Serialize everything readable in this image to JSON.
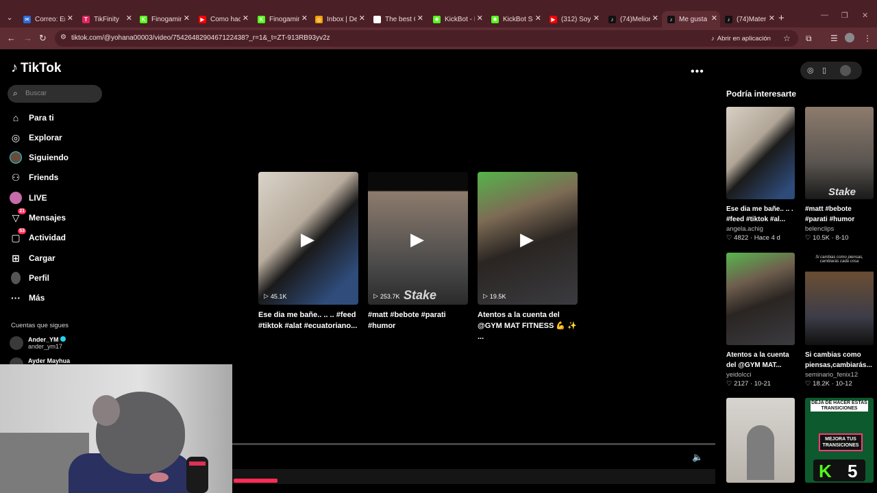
{
  "browser": {
    "tabs": [
      {
        "title": "Correo: En",
        "color": "#2b6cd8",
        "glyph": "✉"
      },
      {
        "title": "TikFinity",
        "color": "#e0245e",
        "glyph": "T"
      },
      {
        "title": "Finogamin",
        "color": "#53fc18",
        "glyph": "K"
      },
      {
        "title": "Como hac",
        "color": "#ff0000",
        "glyph": "▶"
      },
      {
        "title": "Finogamin",
        "color": "#53fc18",
        "glyph": "K"
      },
      {
        "title": "Inbox | De",
        "color": "#f0a000",
        "glyph": "◎"
      },
      {
        "title": "The best C",
        "color": "#ffffff",
        "glyph": "●"
      },
      {
        "title": "KickBot - I",
        "color": "#53fc18",
        "glyph": "✱"
      },
      {
        "title": "KickBot Se",
        "color": "#53fc18",
        "glyph": "✱"
      },
      {
        "title": "(312) Soy",
        "color": "#ff0000",
        "glyph": "▶"
      },
      {
        "title": "(74)Melior",
        "color": "#111111",
        "glyph": "♪"
      },
      {
        "title": "Me gusta",
        "color": "#111111",
        "glyph": "♪",
        "active": true
      },
      {
        "title": "(74)Mater",
        "color": "#111111",
        "glyph": "♪"
      }
    ],
    "url": "tiktok.com/@yohana00003/video/7542648290467122438?_r=1&_t=ZT-913RB93yv2z",
    "open_app": "Abrir en aplicación"
  },
  "tiktok": {
    "logo": "TikTok",
    "search_placeholder": "Buscar",
    "nav": [
      {
        "label": "Para ti",
        "icon": "home-icon",
        "glyph": "⌂"
      },
      {
        "label": "Explorar",
        "icon": "compass-icon",
        "glyph": "◎"
      },
      {
        "label": "Siguiendo",
        "icon": "following-avatar",
        "glyph": ""
      },
      {
        "label": "Friends",
        "icon": "friends-icon",
        "glyph": "⚇"
      },
      {
        "label": "LIVE",
        "icon": "live-icon",
        "glyph": ""
      },
      {
        "label": "Mensajes",
        "icon": "messages-icon",
        "glyph": "▽",
        "badge": "21"
      },
      {
        "label": "Actividad",
        "icon": "activity-icon",
        "glyph": "▢",
        "badge": "53"
      },
      {
        "label": "Cargar",
        "icon": "upload-icon",
        "glyph": "⊞"
      },
      {
        "label": "Perfil",
        "icon": "profile-avatar",
        "glyph": ""
      },
      {
        "label": "Más",
        "icon": "more-icon",
        "glyph": "···"
      }
    ],
    "following_title": "Cuentas que sigues",
    "following": [
      {
        "name": "Ander_YM",
        "handle": "ander_ym17",
        "verified": true
      },
      {
        "name": "Ayder Mayhua",
        "handle": "",
        "verified": false
      }
    ],
    "videos": [
      {
        "views": "45.1K",
        "caption": "Ese dia me bañe.. .. .. #feed #tiktok #alat #ecuatoriano...",
        "stake": ""
      },
      {
        "views": "253.7K",
        "caption": "#matt #bebote #parati #humor",
        "stake": "Stake"
      },
      {
        "views": "19.5K",
        "caption": "Atentos a la cuenta del @GYM MAT FITNESS 💪 ✨ ...",
        "stake": ""
      }
    ],
    "recommend_title": "Podría interesarte",
    "recommendations": [
      {
        "caption": "Ese dia me bañe.. .. . #feed #tiktok #al...",
        "author": "angela.achig",
        "likes": "4822",
        "date": "Hace 4 d",
        "stake": ""
      },
      {
        "caption": "#matt #bebote #parati #humor",
        "author": "belenclips",
        "likes": "10.5K",
        "date": "8-10",
        "stake": "Stake"
      },
      {
        "caption": "Atentos a la cuenta del @GYM MAT...",
        "author": "yeidolcci",
        "likes": "2127",
        "date": "10-21",
        "stake": ""
      },
      {
        "caption": "Si cambias como piensas,cambiarás...",
        "author": "seminario_fenix12",
        "likes": "18.2K",
        "date": "10-12",
        "stake": ""
      }
    ],
    "overlay_texts": {
      "transitions_top": "DEJA DE HACER ESTAS TRANSICIONES",
      "transitions_box": "MEJORA TUS TRANSICIONES",
      "number": "5",
      "quote": "Si cambias como piensas, cambiarás cada cosa"
    }
  }
}
